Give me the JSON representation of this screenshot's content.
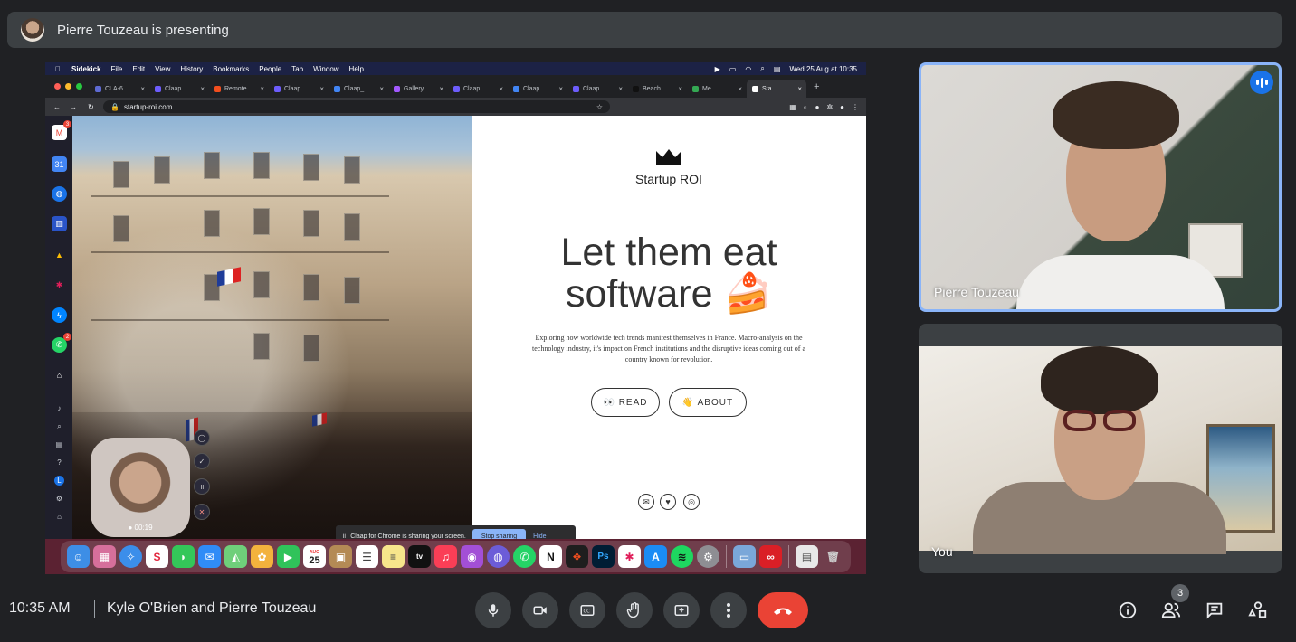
{
  "presenting": {
    "text": "Pierre Touzeau is presenting"
  },
  "mac_menubar": {
    "app": "Sidekick",
    "items": [
      "File",
      "Edit",
      "View",
      "History",
      "Bookmarks",
      "People",
      "Tab",
      "Window",
      "Help"
    ],
    "datetime": "Wed 25 Aug at 10:35"
  },
  "browser": {
    "tabs": [
      {
        "label": "CLA-6",
        "color": "#5e6ad2"
      },
      {
        "label": "Claap",
        "color": "#6d5dfc"
      },
      {
        "label": "Remote",
        "color": "#f24e1e"
      },
      {
        "label": "Claap",
        "color": "#6d5dfc"
      },
      {
        "label": "Claap_",
        "color": "#4285f4"
      },
      {
        "label": "Gallery",
        "color": "#a259ff"
      },
      {
        "label": "Claap",
        "color": "#6d5dfc"
      },
      {
        "label": "Claap",
        "color": "#4285f4"
      },
      {
        "label": "Claap",
        "color": "#6d5dfc"
      },
      {
        "label": "Beach",
        "color": "#111111"
      },
      {
        "label": "Me",
        "color": "#34a853"
      },
      {
        "label": "Sta",
        "color": "#ffffff"
      }
    ],
    "url": "startup-roi.com"
  },
  "site": {
    "name": "Startup ROI",
    "title_line1": "Let them eat",
    "title_line2": "software 🍰",
    "description": "Exploring how worldwide tech trends manifest themselves in France. Macro-analysis on the technology industry, it's impact on French institutions and the disruptive ideas coming out of a country known for revolution.",
    "read_label": "👀 READ",
    "about_label": "👋 ABOUT"
  },
  "sidekick_badges": {
    "gmail": "3",
    "whatsapp": "2"
  },
  "claap": {
    "timer": "● 00:19",
    "notice": "Claap for Chrome is sharing your screen.",
    "stop_label": "Stop sharing",
    "hide_label": "Hide"
  },
  "dock": {
    "calendar_day": "25",
    "calendar_month": "AUG"
  },
  "participants": {
    "pierre": {
      "name": "Pierre Touzeau"
    },
    "you": {
      "name": "You"
    }
  },
  "meeting": {
    "time": "10:35 AM",
    "title": "Kyle O'Brien and Pierre Touzeau",
    "people_count": "3"
  }
}
